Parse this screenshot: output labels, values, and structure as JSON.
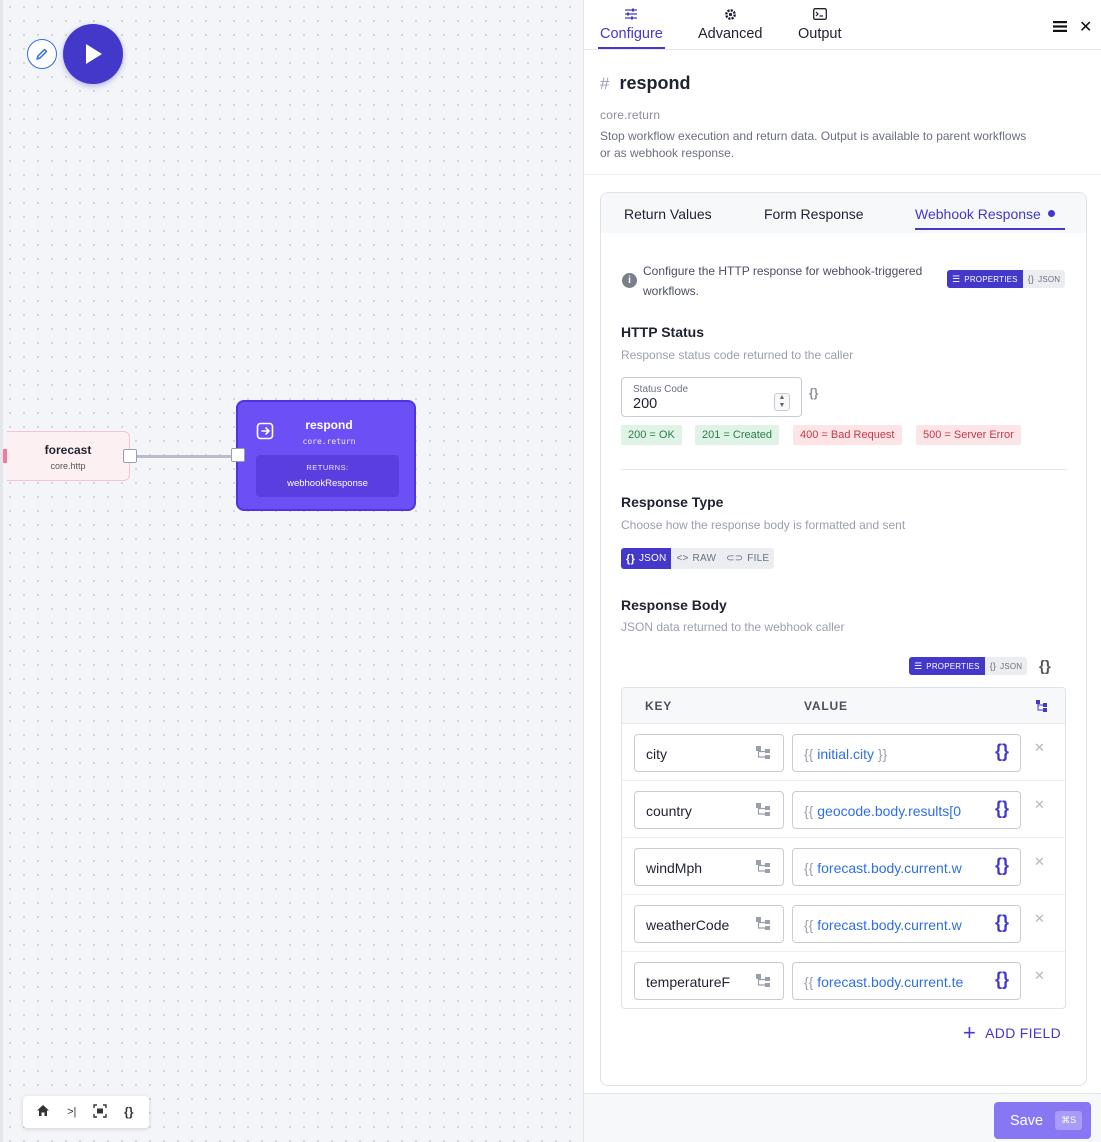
{
  "canvas": {
    "nodes": {
      "forecast": {
        "title": "forecast",
        "subtitle": "core.http"
      },
      "respond": {
        "title": "respond",
        "subtitle": "core.return",
        "returns_label": "RETURNS:",
        "returns_value": "webhookResponse"
      }
    },
    "toolbar": {
      "icons": [
        "home-icon",
        "collapse-icon",
        "fit-view-icon",
        "code-icon"
      ]
    }
  },
  "panel": {
    "tabs": [
      {
        "label": "Configure",
        "icon": "sliders-icon",
        "active": true
      },
      {
        "label": "Advanced",
        "icon": "gear-icon",
        "active": false
      },
      {
        "label": "Output",
        "icon": "terminal-icon",
        "active": false
      }
    ],
    "node": {
      "title": "respond",
      "type": "core.return",
      "description": "Stop workflow execution and return data. Output is available to parent workflows or as webhook response."
    },
    "subtabs": [
      {
        "label": "Return Values",
        "active": false
      },
      {
        "label": "Form Response",
        "active": false
      },
      {
        "label": "Webhook Response",
        "active": true
      }
    ],
    "info": "Configure the HTTP response for webhook-triggered workflows.",
    "mode_toggle": {
      "properties": "PROPERTIES",
      "json": "JSON"
    },
    "http_status": {
      "title": "HTTP Status",
      "subtitle": "Response status code returned to the caller",
      "field_label": "Status Code",
      "field_value": "200",
      "chips": [
        "200 = OK",
        "201 = Created",
        "400 = Bad Request",
        "500 = Server Error"
      ]
    },
    "response_type": {
      "title": "Response Type",
      "subtitle": "Choose how the response body is formatted and sent",
      "options": [
        "JSON",
        "RAW",
        "FILE"
      ],
      "selected": "JSON"
    },
    "response_body": {
      "title": "Response Body",
      "subtitle": "JSON data returned to the webhook caller",
      "columns": [
        "KEY",
        "VALUE"
      ],
      "rows": [
        {
          "key": "city",
          "value": "initial.city",
          "value_tail": " }}"
        },
        {
          "key": "country",
          "value": "geocode.body.results[0",
          "value_tail": ""
        },
        {
          "key": "windMph",
          "value": "forecast.body.current.w",
          "value_tail": ""
        },
        {
          "key": "weatherCode",
          "value": "forecast.body.current.w",
          "value_tail": ""
        },
        {
          "key": "temperatureF",
          "value": "forecast.body.current.te",
          "value_tail": ""
        }
      ],
      "open_brace": "{{ ",
      "add_field": "ADD FIELD"
    },
    "footer": {
      "save_label": "Save",
      "shortcut": "⌘S"
    }
  },
  "colors": {
    "accent": "#4338ca",
    "node_fill": "#6d4ff6",
    "link": "#2f6fe4",
    "ok_chip": "#e0f3e7",
    "err_chip": "#fde4e6"
  }
}
